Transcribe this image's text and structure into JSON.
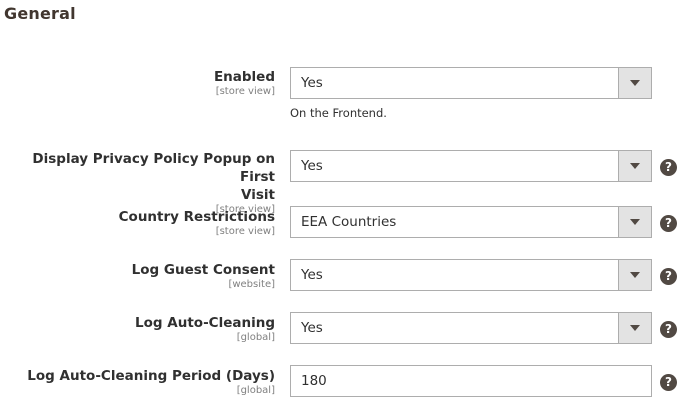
{
  "section": {
    "title": "General"
  },
  "fields": [
    {
      "label": "Enabled",
      "scope": "[store view]",
      "value": "Yes",
      "note": "On the Frontend.",
      "type": "select",
      "help": false
    },
    {
      "label_line1": "Display Privacy Policy Popup on First",
      "label_line2": "Visit",
      "scope": "[store view]",
      "value": "Yes",
      "type": "select",
      "help": true
    },
    {
      "label": "Country Restrictions",
      "scope": "[store view]",
      "value": "EEA Countries",
      "type": "select",
      "help": true
    },
    {
      "label": "Log Guest Consent",
      "scope": "[website]",
      "value": "Yes",
      "type": "select",
      "help": true
    },
    {
      "label": "Log Auto-Cleaning",
      "scope": "[global]",
      "value": "Yes",
      "type": "select",
      "help": true
    },
    {
      "label": "Log Auto-Cleaning Period (Days)",
      "scope": "[global]",
      "value": "180",
      "type": "text",
      "help": true
    }
  ],
  "help_icon": {
    "glyph": "?",
    "icon": "help-icon"
  },
  "colors": {
    "help_bg": "#514943",
    "border": "#adadad",
    "arrow_bg": "#e3e3e3"
  }
}
